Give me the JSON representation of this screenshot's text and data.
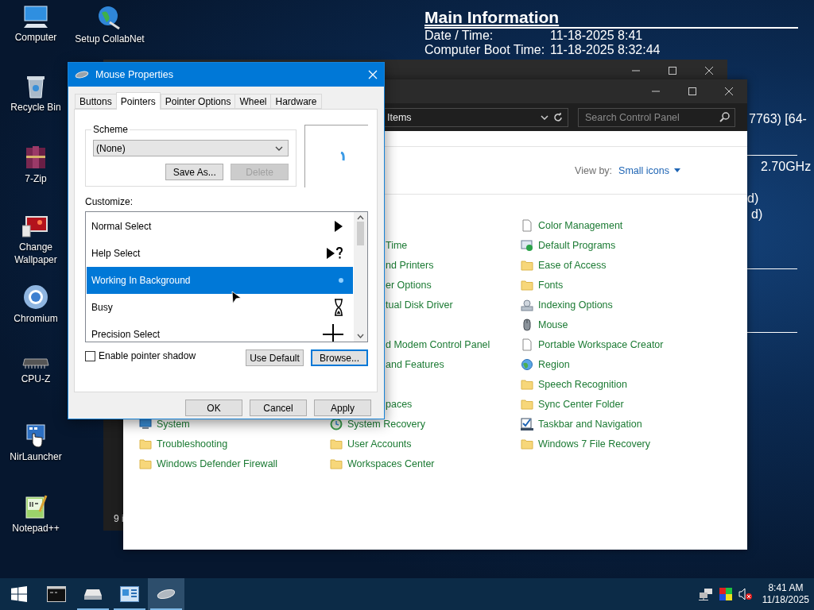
{
  "desktop_icons": [
    {
      "label": "Computer",
      "kind": "computer"
    },
    {
      "label": "Recycle Bin",
      "kind": "recycle-bin"
    },
    {
      "label": "7-Zip",
      "kind": "archive"
    },
    {
      "label": "Change Wallpaper",
      "kind": "wallpaper"
    },
    {
      "label": "Chromium",
      "kind": "browser"
    },
    {
      "label": "CPU-Z",
      "kind": "chip"
    },
    {
      "label": "NirLauncher",
      "kind": "launcher"
    },
    {
      "label": "Notepad++",
      "kind": "notepad"
    },
    {
      "label": "Setup CollabNet",
      "kind": "setup"
    }
  ],
  "system_info": {
    "title": "Main Information",
    "rows": [
      {
        "label": "Date / Time:",
        "value": "11-18-2025 8:41"
      },
      {
        "label": "Computer Boot Time:",
        "value": "11-18-2025 8:32:44"
      }
    ],
    "fragments": [
      {
        "kind": "text",
        "text": "7763) [64-"
      },
      {
        "kind": "rule"
      },
      {
        "kind": "text",
        "text": "2.70GHz"
      },
      {
        "kind": "text",
        "text": "d)"
      },
      {
        "kind": "text",
        "text": "d)"
      },
      {
        "kind": "rule"
      },
      {
        "kind": "rule"
      }
    ]
  },
  "back_window": {
    "status": "9 i"
  },
  "control_panel": {
    "address": "Items",
    "search_placeholder": "Search Control Panel",
    "view_by_label": "View by:",
    "view_by_value": "Small icons",
    "columns": [
      [
        {
          "kind": "covered"
        },
        {
          "kind": "covered"
        },
        {
          "kind": "covered"
        },
        {
          "kind": "covered"
        },
        {
          "kind": "covered"
        },
        {
          "kind": "covered"
        },
        {
          "kind": "covered"
        },
        {
          "kind": "covered"
        },
        {
          "kind": "covered"
        },
        {
          "kind": "covered"
        },
        {
          "label": "System",
          "kind": "monitor"
        },
        {
          "label": "Troubleshooting",
          "kind": "folder"
        },
        {
          "label": "Windows Defender Firewall",
          "kind": "folder"
        }
      ],
      [
        {
          "kind": "covered"
        },
        {
          "label": "Time",
          "kind": "clipped"
        },
        {
          "label": "nd Printers",
          "kind": "clipped"
        },
        {
          "label": "er Options",
          "kind": "clipped"
        },
        {
          "label": "tual Disk Driver",
          "kind": "clipped"
        },
        {
          "kind": "covered"
        },
        {
          "label": "d Modem Control Panel",
          "kind": "clipped"
        },
        {
          "label": "and Features",
          "kind": "clipped"
        },
        {
          "kind": "covered"
        },
        {
          "label": "paces",
          "kind": "clipped"
        },
        {
          "label": "System Recovery",
          "kind": "recovery"
        },
        {
          "label": "User Accounts",
          "kind": "folder"
        },
        {
          "label": "Workspaces Center",
          "kind": "folder"
        }
      ],
      [
        {
          "label": "Color Management",
          "kind": "page"
        },
        {
          "label": "Default Programs",
          "kind": "programs"
        },
        {
          "label": "Ease of Access",
          "kind": "folder"
        },
        {
          "label": "Fonts",
          "kind": "folder"
        },
        {
          "label": "Indexing Options",
          "kind": "indexing"
        },
        {
          "label": "Mouse",
          "kind": "mouse"
        },
        {
          "label": "Portable Workspace Creator",
          "kind": "page"
        },
        {
          "label": "Region",
          "kind": "globe"
        },
        {
          "label": "Speech Recognition",
          "kind": "folder"
        },
        {
          "label": "Sync Center Folder",
          "kind": "folder"
        },
        {
          "label": "Taskbar and Navigation",
          "kind": "taskbar"
        },
        {
          "label": "Windows 7 File Recovery",
          "kind": "folder"
        }
      ]
    ]
  },
  "dialog": {
    "title": "Mouse Properties",
    "tabs": [
      {
        "label": "Buttons",
        "selected": false
      },
      {
        "label": "Pointers",
        "selected": true
      },
      {
        "label": "Pointer Options",
        "selected": false
      },
      {
        "label": "Wheel",
        "selected": false
      },
      {
        "label": "Hardware",
        "selected": false
      }
    ],
    "scheme": {
      "label": "Scheme",
      "value": "(None)",
      "buttons": [
        {
          "label": "Save As...",
          "disabled": false
        },
        {
          "label": "Delete",
          "disabled": true
        }
      ]
    },
    "customize_label": "Customize:",
    "pointers": [
      {
        "name": "Normal Select",
        "kind": "arrow",
        "selected": false
      },
      {
        "name": "Help Select",
        "kind": "help",
        "selected": false
      },
      {
        "name": "Working In Background",
        "kind": "working",
        "selected": true
      },
      {
        "name": "Busy",
        "kind": "hourglass",
        "selected": false
      },
      {
        "name": "Precision Select",
        "kind": "crosshair",
        "selected": false
      }
    ],
    "shadow": {
      "label": "Enable pointer shadow",
      "checked": false
    },
    "list_buttons": [
      {
        "label": "Use Default",
        "focused": false
      },
      {
        "label": "Browse...",
        "focused": true
      }
    ],
    "buttons": [
      {
        "label": "OK"
      },
      {
        "label": "Cancel"
      },
      {
        "label": "Apply"
      }
    ]
  },
  "taskbar": {
    "items": [
      {
        "kind": "start"
      },
      {
        "kind": "terminal",
        "running": false,
        "active": false
      },
      {
        "kind": "drive",
        "running": true,
        "active": false
      },
      {
        "kind": "control-panel",
        "running": true,
        "active": false
      },
      {
        "kind": "mouse",
        "running": true,
        "active": true
      }
    ],
    "tray": [
      {
        "kind": "network"
      },
      {
        "kind": "color"
      },
      {
        "kind": "volume-muted"
      }
    ],
    "time": "8:41 AM",
    "date": "11/18/2025"
  }
}
